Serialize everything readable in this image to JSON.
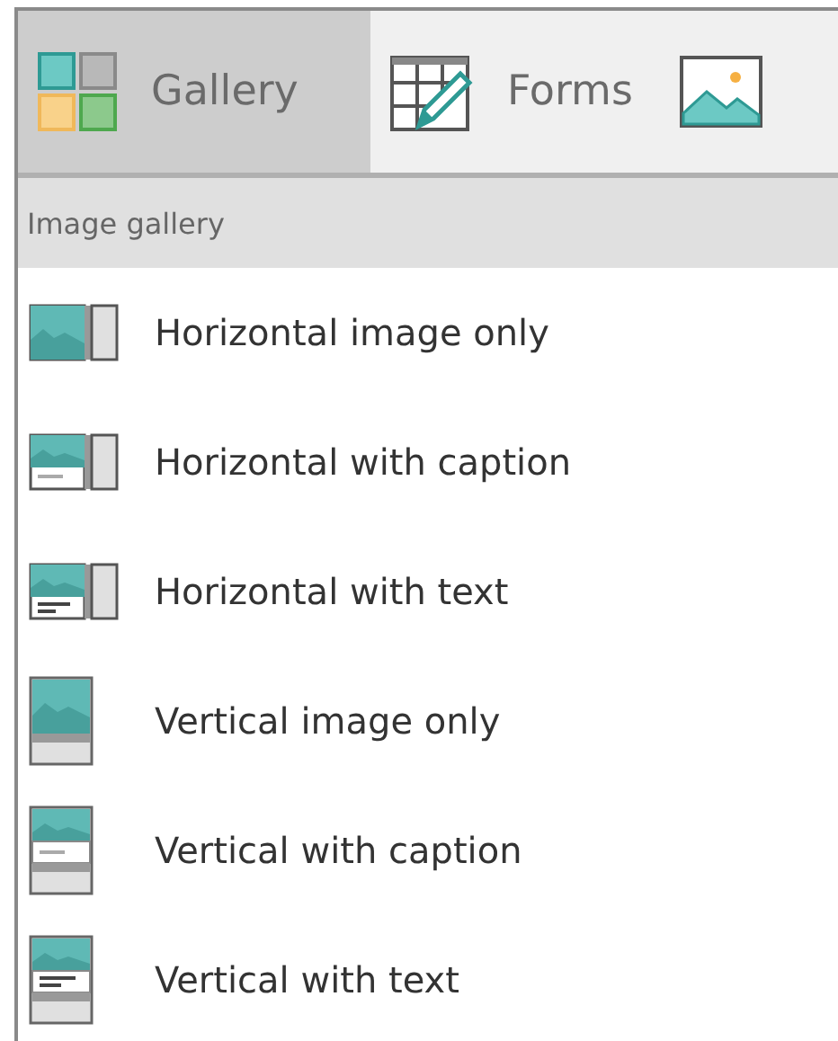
{
  "tabs": [
    {
      "kind": "gallery",
      "label": "Gallery",
      "selected": true
    },
    {
      "kind": "forms",
      "label": "Forms",
      "selected": false
    },
    {
      "kind": "image",
      "selected": false
    }
  ],
  "section": {
    "title": "Image gallery"
  },
  "items": [
    {
      "kind": "himage",
      "label": "Horizontal image only"
    },
    {
      "kind": "hcaption",
      "label": "Horizontal with caption"
    },
    {
      "kind": "htext",
      "label": "Horizontal with text"
    },
    {
      "kind": "vimage",
      "label": "Vertical image only"
    },
    {
      "kind": "vcaption",
      "label": "Vertical with caption"
    },
    {
      "kind": "vtext",
      "label": "Vertical with text"
    }
  ]
}
